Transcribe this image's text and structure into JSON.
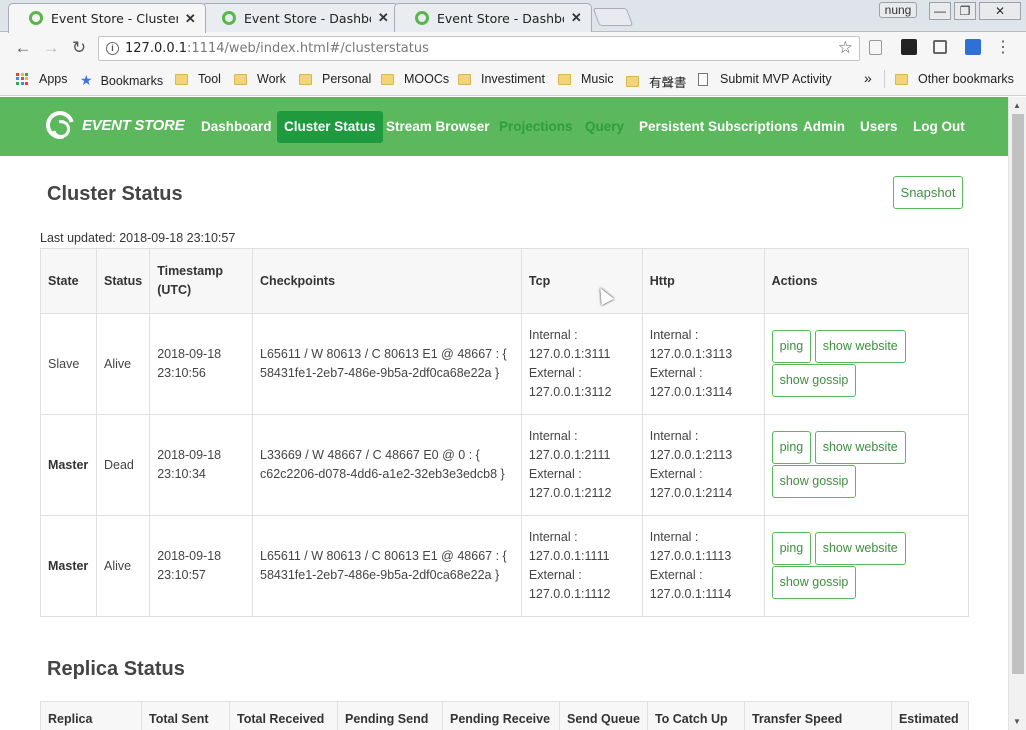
{
  "browser": {
    "tabs": [
      {
        "title": "Event Store - Cluster Stat",
        "active": true
      },
      {
        "title": "Event Store - Dashboard",
        "active": false
      },
      {
        "title": "Event Store - Dashboard",
        "active": false
      }
    ],
    "tab_close": "✕",
    "profile": "nung",
    "window_controls": {
      "minimize": "—",
      "restore": "❐",
      "close": "✕"
    },
    "url_host": "127.0.0.1",
    "url_rest": ":1114/web/index.html#/clusterstatus",
    "nav": {
      "back": "←",
      "forward": "→",
      "reload": "↻",
      "star": "☆",
      "menu": "⋮",
      "info": "i"
    },
    "bookmarks": [
      {
        "label": "Apps",
        "icon": "apps-grid-icon"
      },
      {
        "label": "Bookmarks",
        "icon": "star-icon"
      },
      {
        "label": "Tool",
        "icon": "folder-icon"
      },
      {
        "label": "Work",
        "icon": "folder-icon"
      },
      {
        "label": "Personal",
        "icon": "folder-icon"
      },
      {
        "label": "MOOCs",
        "icon": "folder-icon"
      },
      {
        "label": "Investiment",
        "icon": "folder-icon"
      },
      {
        "label": "Music",
        "icon": "folder-icon"
      },
      {
        "label": "有聲書",
        "icon": "folder-icon"
      },
      {
        "label": "Submit MVP Activity",
        "icon": "page-icon"
      }
    ],
    "bookmarks_overflow": "»",
    "other_bookmarks": "Other bookmarks"
  },
  "app": {
    "logo": "EVENT STORE",
    "nav": [
      {
        "label": "Dashboard",
        "state": "normal"
      },
      {
        "label": "Cluster Status",
        "state": "active"
      },
      {
        "label": "Stream Browser",
        "state": "normal"
      },
      {
        "label": "Projections",
        "state": "muted"
      },
      {
        "label": "Query",
        "state": "muted"
      },
      {
        "label": "Persistent Subscriptions",
        "state": "normal"
      },
      {
        "label": "Admin",
        "state": "normal"
      },
      {
        "label": "Users",
        "state": "normal"
      },
      {
        "label": "Log Out",
        "state": "normal"
      }
    ],
    "colors": {
      "brand_green": "#5cb85c",
      "active_green": "#1f9a3f"
    }
  },
  "cluster": {
    "title": "Cluster Status",
    "snapshot_label": "Snapshot",
    "last_updated": "Last updated: 2018-09-18 23:10:57",
    "headers": {
      "state": "State",
      "status": "Status",
      "timestamp": "Timestamp (UTC)",
      "checkpoints": "Checkpoints",
      "tcp": "Tcp",
      "http": "Http",
      "actions": "Actions"
    },
    "rows": [
      {
        "state": "Slave",
        "state_bold": false,
        "status": "Alive",
        "timestamp": "2018-09-18 23:10:56",
        "checkpoints": "L65611 / W 80613 / C 80613 E1 @ 48667 : { 58431fe1-2eb7-486e-9b5a-2df0ca68e22a }",
        "tcp_internal": "Internal : 127.0.0.1:3111",
        "tcp_external": "External : 127.0.0.1:3112",
        "http_internal": "Internal : 127.0.0.1:3113",
        "http_external": "External : 127.0.0.1:3114"
      },
      {
        "state": "Master",
        "state_bold": true,
        "status": "Dead",
        "timestamp": "2018-09-18 23:10:34",
        "checkpoints": "L33669 / W 48667 / C 48667 E0 @ 0 : { c62c2206-d078-4dd6-a1e2-32eb3e3edcb8 }",
        "tcp_internal": "Internal : 127.0.0.1:2111",
        "tcp_external": "External : 127.0.0.1:2112",
        "http_internal": "Internal : 127.0.0.1:2113",
        "http_external": "External : 127.0.0.1:2114"
      },
      {
        "state": "Master",
        "state_bold": true,
        "status": "Alive",
        "timestamp": "2018-09-18 23:10:57",
        "checkpoints": "L65611 / W 80613 / C 80613 E1 @ 48667 : { 58431fe1-2eb7-486e-9b5a-2df0ca68e22a }",
        "tcp_internal": "Internal : 127.0.0.1:1111",
        "tcp_external": "External : 127.0.0.1:1112",
        "http_internal": "Internal : 127.0.0.1:1113",
        "http_external": "External : 127.0.0.1:1114"
      }
    ],
    "actions": {
      "ping": "ping",
      "website": "show website",
      "gossip": "show gossip"
    }
  },
  "replica": {
    "title": "Replica Status",
    "headers": [
      "Replica",
      "Total Sent",
      "Total Received",
      "Pending Send",
      "Pending Receive",
      "Send Queue",
      "To Catch Up",
      "Transfer Speed",
      "Estimated"
    ]
  }
}
